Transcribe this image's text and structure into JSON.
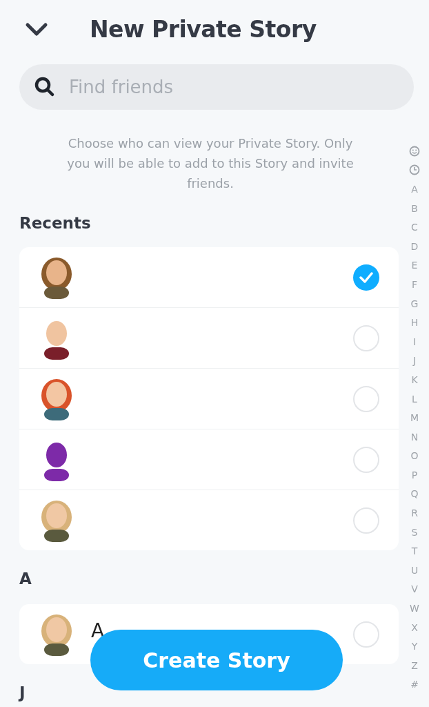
{
  "header": {
    "title": "New Private Story"
  },
  "search": {
    "placeholder": "Find friends"
  },
  "description": "Choose who can view your Private Story. Only you will be able to add to this Story and invite friends.",
  "sections": [
    {
      "heading": "Recents",
      "friends": [
        {
          "selected": true
        },
        {
          "selected": false
        },
        {
          "selected": false
        },
        {
          "selected": false
        },
        {
          "selected": false
        }
      ]
    },
    {
      "heading": "A",
      "friends": [
        {
          "name": "A",
          "selected": false
        }
      ]
    },
    {
      "heading": "J"
    }
  ],
  "index": [
    "A",
    "B",
    "C",
    "D",
    "E",
    "F",
    "G",
    "H",
    "I",
    "J",
    "K",
    "L",
    "M",
    "N",
    "O",
    "P",
    "Q",
    "R",
    "S",
    "T",
    "U",
    "V",
    "W",
    "X",
    "Y",
    "Z",
    "#"
  ],
  "button": {
    "label": "Create Story"
  }
}
